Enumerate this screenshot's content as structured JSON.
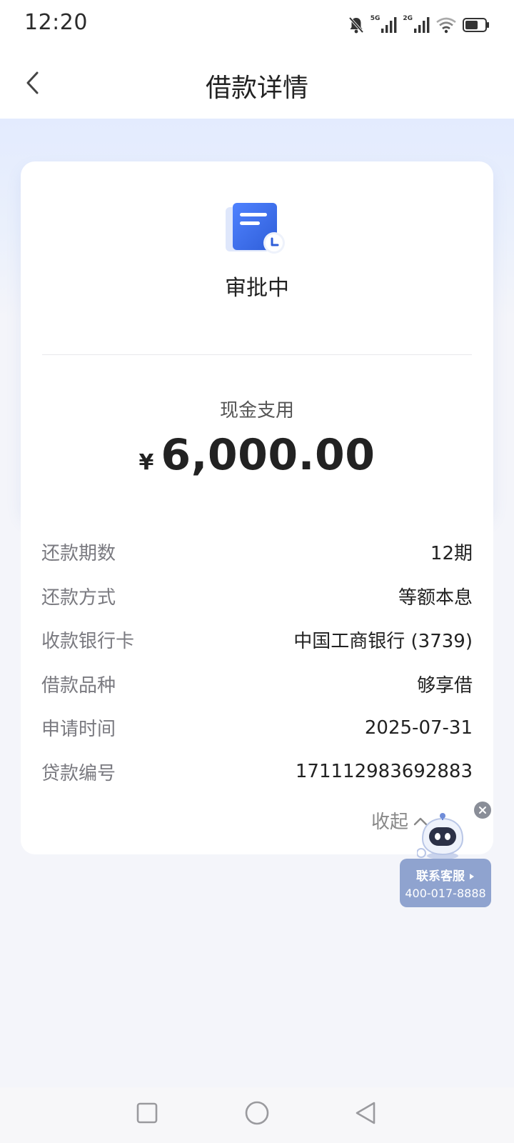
{
  "status_bar": {
    "time": "12:20",
    "icons": [
      "bell-muted-icon",
      "signal-5g-icon",
      "signal-2g-icon",
      "wifi-icon",
      "battery-icon"
    ],
    "signal_labels": [
      "5G",
      "2G"
    ]
  },
  "nav": {
    "title": "借款详情",
    "back_icon": "chevron-left-icon"
  },
  "summary": {
    "status_icon": "document-pending-icon",
    "status_text": "审批中",
    "amount_label": "现金支用",
    "currency": "¥",
    "amount": "6,000.00"
  },
  "details": [
    {
      "key": "还款期数",
      "value": "12期"
    },
    {
      "key": "还款方式",
      "value": "等额本息"
    },
    {
      "key": "收款银行卡",
      "value": "中国工商银行 (3739)"
    },
    {
      "key": "借款品种",
      "value": "够享借"
    },
    {
      "key": "申请时间",
      "value": "2025-07-31"
    },
    {
      "key": "贷款编号",
      "value": "171112983692883"
    }
  ],
  "collapse_label": "收起",
  "customer_service": {
    "title": "联系客服",
    "phone": "400-017-8888",
    "close_icon": "close-icon",
    "robot_icon": "robot-icon"
  },
  "colors": {
    "accent_blue": "#3a6ae0",
    "hero_gradient_top": "#e3ebfe",
    "page_bg": "#f4f5fa",
    "cs_box": "#8fa3cf"
  }
}
